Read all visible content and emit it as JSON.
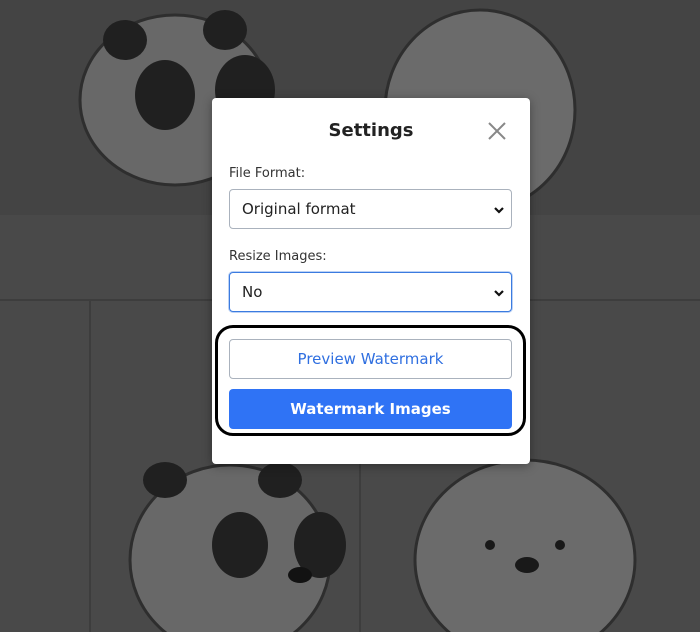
{
  "modal": {
    "title": "Settings",
    "close_icon": "close-icon",
    "file_format": {
      "label": "File Format:",
      "selected": "Original format"
    },
    "resize_images": {
      "label": "Resize Images:",
      "selected": "No"
    },
    "preview_button": "Preview Watermark",
    "watermark_button": "Watermark Images"
  },
  "colors": {
    "accent": "#2f73f5",
    "link_text": "#2f6fe0",
    "focus_border": "#3b7be0",
    "highlight_ring": "#000000"
  }
}
